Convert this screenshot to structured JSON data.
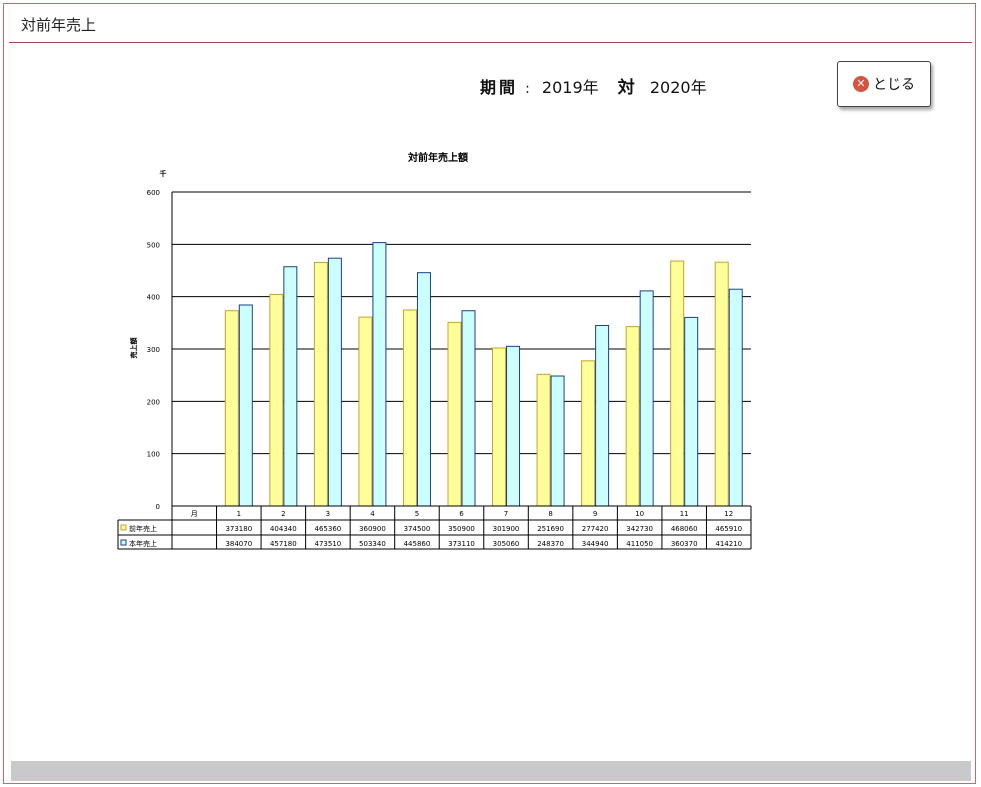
{
  "window": {
    "title": "対前年売上"
  },
  "period": {
    "label": "期間",
    "separator": ":",
    "from": "2019年",
    "vs": "対",
    "to": "2020年"
  },
  "close_button": {
    "label": "とじる",
    "icon": "close-circle-icon"
  },
  "colors": {
    "prev_fill": "#ffff99",
    "prev_stroke": "#c8a032",
    "curr_fill": "#ccffff",
    "curr_stroke": "#1f3d8a"
  },
  "chart_data": {
    "type": "bar",
    "title": "対前年売上額",
    "unit_label": "千",
    "ylabel": "売上額",
    "xlabel": "月",
    "ylim": [
      0,
      600
    ],
    "y_ticks": [
      0,
      100,
      200,
      300,
      400,
      500,
      600
    ],
    "categories": [
      "1",
      "2",
      "3",
      "4",
      "5",
      "6",
      "7",
      "8",
      "9",
      "10",
      "11",
      "12"
    ],
    "grid": true,
    "series": [
      {
        "name": "前年売上",
        "values": [
          373180,
          404340,
          465360,
          360900,
          374500,
          350900,
          301900,
          251690,
          277420,
          342730,
          468060,
          465910
        ]
      },
      {
        "name": "本年売上",
        "values": [
          384070,
          457180,
          473510,
          503340,
          445860,
          373110,
          305060,
          248370,
          344940,
          411050,
          360370,
          414210
        ]
      }
    ]
  }
}
